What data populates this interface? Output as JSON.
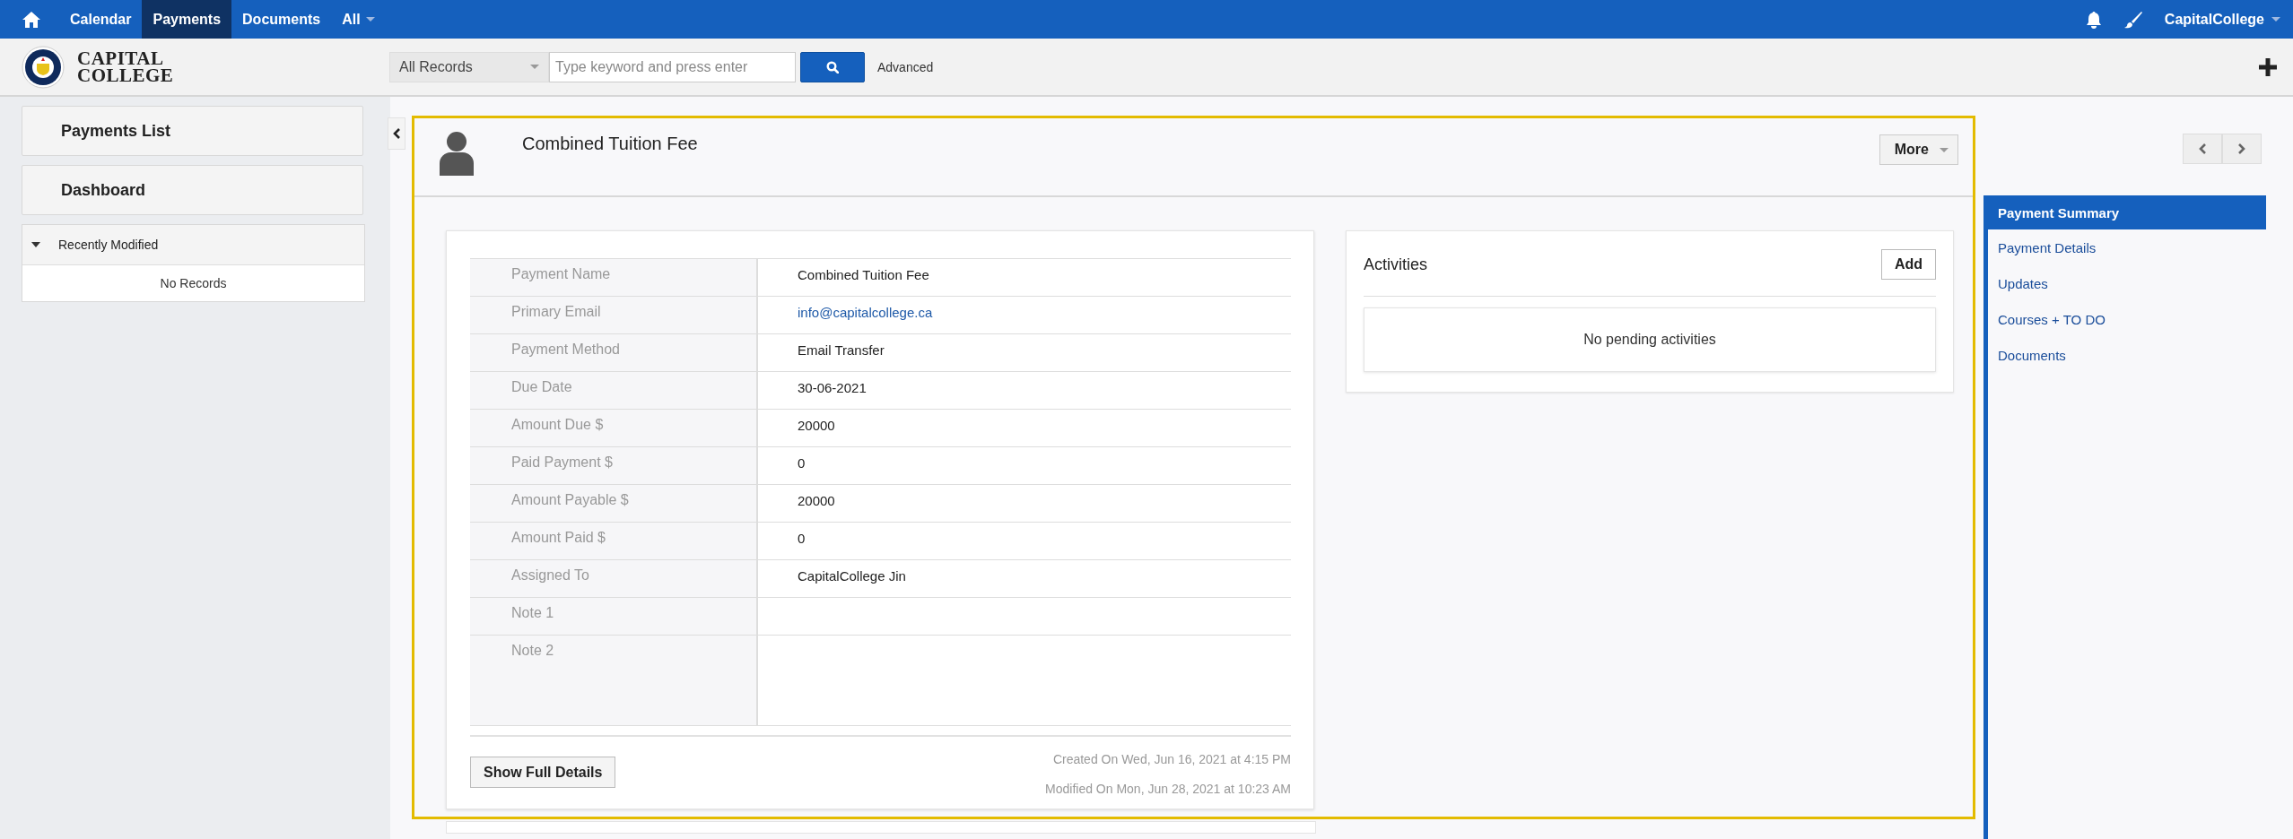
{
  "top_nav": {
    "items": [
      {
        "label": "Calendar",
        "selected": false,
        "dropdown": false
      },
      {
        "label": "Payments",
        "selected": true,
        "dropdown": false
      },
      {
        "label": "Documents",
        "selected": false,
        "dropdown": false
      },
      {
        "label": "All",
        "selected": false,
        "dropdown": true
      }
    ],
    "user": "CapitalCollege"
  },
  "header": {
    "logo_text": "CAPITAL COLLEGE",
    "search": {
      "scope": "All Records",
      "placeholder": "Type keyword and press enter"
    },
    "advanced": "Advanced"
  },
  "sidebar": {
    "items": [
      "Payments List",
      "Dashboard"
    ],
    "recent": {
      "title": "Recently Modified",
      "expanded": true,
      "empty_text": "No Records"
    }
  },
  "record": {
    "title": "Combined Tuition Fee",
    "more": "More",
    "fields": [
      {
        "label": "Payment Name",
        "value": "Combined Tuition Fee",
        "kind": "text"
      },
      {
        "label": "Primary Email",
        "value": "info@capitalcollege.ca",
        "kind": "link"
      },
      {
        "label": "Payment Method",
        "value": "Email Transfer",
        "kind": "text"
      },
      {
        "label": "Due Date",
        "value": "30-06-2021",
        "kind": "text"
      },
      {
        "label": "Amount Due $",
        "value": "20000",
        "kind": "text"
      },
      {
        "label": "Paid Payment $",
        "value": "0",
        "kind": "text"
      },
      {
        "label": "Amount Payable $",
        "value": "20000",
        "kind": "text"
      },
      {
        "label": "Amount Paid $",
        "value": "0",
        "kind": "text"
      },
      {
        "label": "Assigned To",
        "value": "CapitalCollege Jin",
        "kind": "text"
      },
      {
        "label": "Note 1",
        "kind": "text"
      },
      {
        "label": "Note 2",
        "kind": "multiline"
      }
    ],
    "show_details": "Show Full Details",
    "created": "Created On Wed, Jun 16, 2021 at 4:15 PM",
    "modified": "Modified On Mon, Jun 28, 2021 at 10:23 AM",
    "activities": {
      "title": "Activities",
      "add": "Add",
      "empty_text": "No pending activities"
    }
  },
  "right_nav": {
    "items": [
      {
        "label": "Payment Summary",
        "selected": true
      },
      {
        "label": "Payment Details",
        "selected": false
      },
      {
        "label": "Updates",
        "selected": false
      },
      {
        "label": "Courses + TO DO",
        "selected": false
      },
      {
        "label": "Documents",
        "selected": false
      }
    ]
  }
}
